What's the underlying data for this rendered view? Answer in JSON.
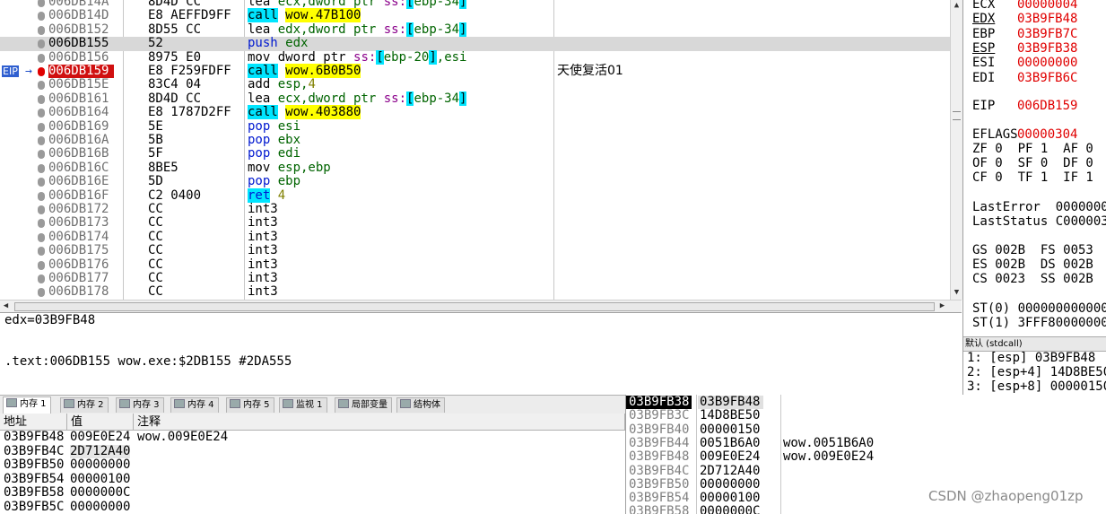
{
  "disassembly": {
    "rows": [
      {
        "addr": "006DB14A",
        "hex": "8D4D CC",
        "asm": [
          "t-int",
          "lea ",
          "t-reg",
          "ecx,dword ptr ",
          "t-seg",
          "ss:",
          "t-brk",
          "[",
          "t-reg",
          "ebp-34",
          "t-brk",
          "]"
        ],
        "comment": ""
      },
      {
        "addr": "006DB14D",
        "hex": "E8 AEFFD9FF",
        "asm": [
          "t-call",
          "call",
          " ",
          " ",
          "t-tgt",
          "wow.47B100"
        ],
        "comment": ""
      },
      {
        "addr": "006DB152",
        "hex": "8D55 CC",
        "asm": [
          "t-int",
          "lea ",
          "t-reg",
          "edx,dword ptr ",
          "t-seg",
          "ss:",
          "t-brk",
          "[",
          "t-reg",
          "ebp-34",
          "t-brk",
          "]"
        ],
        "comment": ""
      },
      {
        "addr": "006DB155",
        "hex": "52",
        "asm": [
          "t-push",
          "push ",
          "t-reg",
          "edx"
        ],
        "comment": ""
      },
      {
        "addr": "006DB156",
        "hex": "8975 E0",
        "asm": [
          "t-int",
          "mov dword ptr ",
          "t-seg",
          "ss:",
          "t-brk",
          "[",
          "t-reg",
          "ebp-20",
          "t-brk",
          "]",
          "t-reg",
          ",esi"
        ],
        "comment": ""
      },
      {
        "addr": "006DB159",
        "hex": "E8 F259FDFF",
        "asm": [
          "t-call",
          "call",
          " ",
          " ",
          "t-tgt",
          "wow.6B0B50"
        ],
        "comment": "天使复活01"
      },
      {
        "addr": "006DB15E",
        "hex": "83C4 04",
        "asm": [
          "t-int",
          "add ",
          "t-reg",
          "esp,",
          "t-num",
          "4"
        ],
        "comment": ""
      },
      {
        "addr": "006DB161",
        "hex": "8D4D CC",
        "asm": [
          "t-int",
          "lea ",
          "t-reg",
          "ecx,dword ptr ",
          "t-seg",
          "ss:",
          "t-brk",
          "[",
          "t-reg",
          "ebp-34",
          "t-brk",
          "]"
        ],
        "comment": ""
      },
      {
        "addr": "006DB164",
        "hex": "E8 1787D2FF",
        "asm": [
          "t-call",
          "call",
          " ",
          " ",
          "t-tgt",
          "wow.403880"
        ],
        "comment": ""
      },
      {
        "addr": "006DB169",
        "hex": "5E",
        "asm": [
          "t-pop",
          "pop ",
          "t-reg",
          "esi"
        ],
        "comment": ""
      },
      {
        "addr": "006DB16A",
        "hex": "5B",
        "asm": [
          "t-pop",
          "pop ",
          "t-reg",
          "ebx"
        ],
        "comment": ""
      },
      {
        "addr": "006DB16B",
        "hex": "5F",
        "asm": [
          "t-pop",
          "pop ",
          "t-reg",
          "edi"
        ],
        "comment": ""
      },
      {
        "addr": "006DB16C",
        "hex": "8BE5",
        "asm": [
          "t-int",
          "mov ",
          "t-reg",
          "esp,ebp"
        ],
        "comment": ""
      },
      {
        "addr": "006DB16E",
        "hex": "5D",
        "asm": [
          "t-pop",
          "pop ",
          "t-reg",
          "ebp"
        ],
        "comment": ""
      },
      {
        "addr": "006DB16F",
        "hex": "C2 0400",
        "asm": [
          "t-ret",
          "ret",
          " ",
          " ",
          "t-num",
          "4"
        ],
        "comment": ""
      },
      {
        "addr": "006DB172",
        "hex": "CC",
        "asm": [
          "t-int",
          "int3"
        ],
        "comment": ""
      },
      {
        "addr": "006DB173",
        "hex": "CC",
        "asm": [
          "t-int",
          "int3"
        ],
        "comment": ""
      },
      {
        "addr": "006DB174",
        "hex": "CC",
        "asm": [
          "t-int",
          "int3"
        ],
        "comment": ""
      },
      {
        "addr": "006DB175",
        "hex": "CC",
        "asm": [
          "t-int",
          "int3"
        ],
        "comment": ""
      },
      {
        "addr": "006DB176",
        "hex": "CC",
        "asm": [
          "t-int",
          "int3"
        ],
        "comment": ""
      },
      {
        "addr": "006DB177",
        "hex": "CC",
        "asm": [
          "t-int",
          "int3"
        ],
        "comment": ""
      },
      {
        "addr": "006DB178",
        "hex": "CC",
        "asm": [
          "t-int",
          "int3"
        ],
        "comment": ""
      }
    ],
    "selected_index": 3,
    "eip_index": 5,
    "eip_label": "EIP",
    "eip_arrow": "→"
  },
  "registers": {
    "lines": [
      {
        "name": "ECX",
        "value": "00000004",
        "u": false
      },
      {
        "name": "EDX",
        "value": "03B9FB48",
        "u": true
      },
      {
        "name": "EBP",
        "value": "03B9FB7C",
        "u": false
      },
      {
        "name": "ESP",
        "value": "03B9FB38",
        "u": true
      },
      {
        "name": "ESI",
        "value": "00000000",
        "u": false
      },
      {
        "name": "EDI",
        "value": "03B9FB6C",
        "u": false
      }
    ],
    "eip": {
      "name": "EIP",
      "value": "006DB159"
    },
    "eflags": {
      "name": "EFLAGS",
      "value": "00000304"
    },
    "flags": [
      "ZF 0  PF 1  AF 0",
      "OF 0  SF 0  DF 0",
      "CF 0  TF 1  IF 1"
    ],
    "last_error": "LastError  0000000",
    "last_status": "LastStatus C000003",
    "segments": [
      "GS 002B  FS 0053",
      "ES 002B  DS 002B",
      "CS 0023  SS 002B"
    ],
    "st": [
      "ST(0) 000000000000",
      "ST(1) 3FFF80000000"
    ]
  },
  "call_pane": {
    "header": "默认 (stdcall)",
    "lines": [
      "1: [esp] 03B9FB48",
      "2: [esp+4] 14D8BE50",
      "3: [esp+8] 00000150"
    ]
  },
  "info": {
    "line1": "edx=03B9FB48",
    "line2": ".text:006DB155 wow.exe:$2DB155 #2DA555"
  },
  "tabs": [
    {
      "label": "内存 1",
      "active": true
    },
    {
      "label": "内存 2",
      "active": false
    },
    {
      "label": "内存 3",
      "active": false
    },
    {
      "label": "内存 4",
      "active": false
    },
    {
      "label": "内存 5",
      "active": false
    },
    {
      "label": "监视 1",
      "active": false
    },
    {
      "label": "局部变量",
      "active": false
    },
    {
      "label": "结构体",
      "active": false
    }
  ],
  "dump": {
    "headers": {
      "addr": "地址",
      "value": "值",
      "comment": "注释"
    },
    "rows": [
      {
        "a": "03B9FB48",
        "v": "009E0E24",
        "c": "wow.009E0E24",
        "hl": false
      },
      {
        "a": "03B9FB4C",
        "v": "2D712A40",
        "c": "",
        "hl": true
      },
      {
        "a": "03B9FB50",
        "v": "00000000",
        "c": "",
        "hl": false
      },
      {
        "a": "03B9FB54",
        "v": "00000100",
        "c": "",
        "hl": false
      },
      {
        "a": "03B9FB58",
        "v": "0000000C",
        "c": "",
        "hl": false
      },
      {
        "a": "03B9FB5C",
        "v": "00000000",
        "c": "",
        "hl": false
      }
    ]
  },
  "stack": {
    "rows": [
      {
        "a": "03B9FB38",
        "v": "03B9FB48",
        "c": "",
        "top": true
      },
      {
        "a": "03B9FB3C",
        "v": "14D8BE50",
        "c": "",
        "top": false
      },
      {
        "a": "03B9FB40",
        "v": "00000150",
        "c": "",
        "top": false
      },
      {
        "a": "03B9FB44",
        "v": "0051B6A0",
        "c": "wow.0051B6A0",
        "top": false
      },
      {
        "a": "03B9FB48",
        "v": "009E0E24",
        "c": "wow.009E0E24",
        "top": false
      },
      {
        "a": "03B9FB4C",
        "v": "2D712A40",
        "c": "",
        "top": false
      },
      {
        "a": "03B9FB50",
        "v": "00000000",
        "c": "",
        "top": false
      },
      {
        "a": "03B9FB54",
        "v": "00000100",
        "c": "",
        "top": false
      },
      {
        "a": "03B9FB58",
        "v": "0000000C",
        "c": "",
        "top": false
      }
    ]
  },
  "watermark": "CSDN @zhaopeng01zp"
}
